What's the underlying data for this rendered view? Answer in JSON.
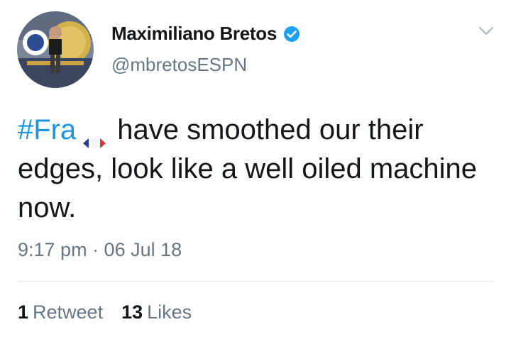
{
  "tweet": {
    "author": {
      "display_name": "Maximiliano Bretos",
      "handle": "@mbretosESPN",
      "verified": true,
      "avatar_icon": "profile-photo-icon"
    },
    "text": {
      "hashtag": "#Fra",
      "flag_icon": "france-flag-icon",
      "body": "have smoothed our their edges, look like a well oiled machine now."
    },
    "timestamp": "9:17 pm · 06 Jul 18",
    "stats": {
      "retweets": {
        "count": "1",
        "label": "Retweet"
      },
      "likes": {
        "count": "13",
        "label": "Likes"
      }
    }
  },
  "colors": {
    "link": "#1b95e0",
    "secondary_text": "#657786",
    "primary_text": "#14171a",
    "divider": "#e1e8ed",
    "verified_badge": "#1da1f2"
  }
}
